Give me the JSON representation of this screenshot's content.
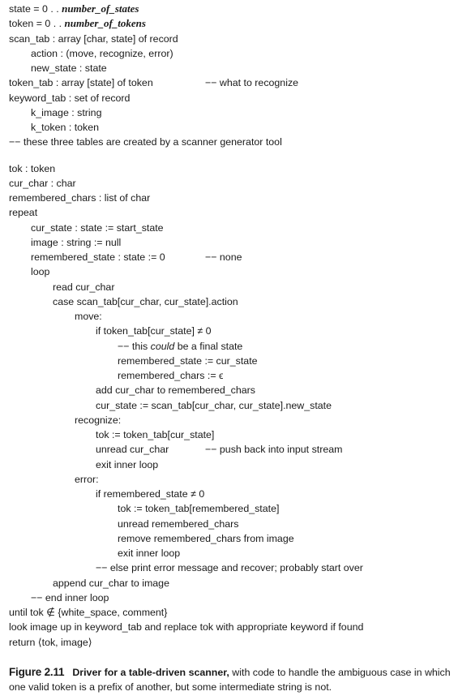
{
  "code": {
    "l01_a": "state = 0 . . ",
    "l01_b": "number_of_states",
    "l02_a": "token = 0 . . ",
    "l02_b": "number_of_tokens",
    "l03": "scan_tab : array [char, state] of record",
    "l04": "action : (move, recognize, error)",
    "l05": "new_state : state",
    "l06": "token_tab : array [state] of token",
    "l06_c": "−− what to recognize",
    "l07": "keyword_tab : set of record",
    "l08": "k_image : string",
    "l09": "k_token : token",
    "l10": "−− these three tables are created by a scanner generator tool",
    "l11": "tok : token",
    "l12": "cur_char : char",
    "l13": "remembered_chars : list of char",
    "l14": "repeat",
    "l15": "cur_state : state := start_state",
    "l16": "image : string := null",
    "l17": "remembered_state : state := 0",
    "l17_c": "−− none",
    "l18": "loop",
    "l19": "read cur_char",
    "l20": "case scan_tab[cur_char, cur_state].action",
    "l21": "move:",
    "l22": "if token_tab[cur_state] ≠ 0",
    "l23_a": "−− this ",
    "l23_b": "could",
    "l23_c": " be a final state",
    "l24": "remembered_state := cur_state",
    "l25": "remembered_chars := ϵ",
    "l26": "add cur_char to remembered_chars",
    "l27": "cur_state := scan_tab[cur_char, cur_state].new_state",
    "l28": "recognize:",
    "l29": "tok := token_tab[cur_state]",
    "l30": "unread cur_char",
    "l30_c": "−− push back into input stream",
    "l31": "exit inner loop",
    "l32": "error:",
    "l33": "if remembered_state ≠ 0",
    "l34": "tok := token_tab[remembered_state]",
    "l35": "unread remembered_chars",
    "l36": "remove remembered_chars from image",
    "l37": "exit inner loop",
    "l38": "−− else print error message and recover; probably start over",
    "l39": "append cur_char to image",
    "l40": "−− end inner loop",
    "l41": "until tok ∉ {white_space, comment}",
    "l42": "look image up in keyword_tab and replace tok with appropriate keyword if found",
    "l43": "return ⟨tok, image⟩"
  },
  "caption": {
    "label": "Figure 2.11",
    "bold_text": "Driver for a table-driven scanner,",
    "text": " with code to handle the ambiguous case in which one valid token is a prefix of another, but some intermediate string is not."
  }
}
